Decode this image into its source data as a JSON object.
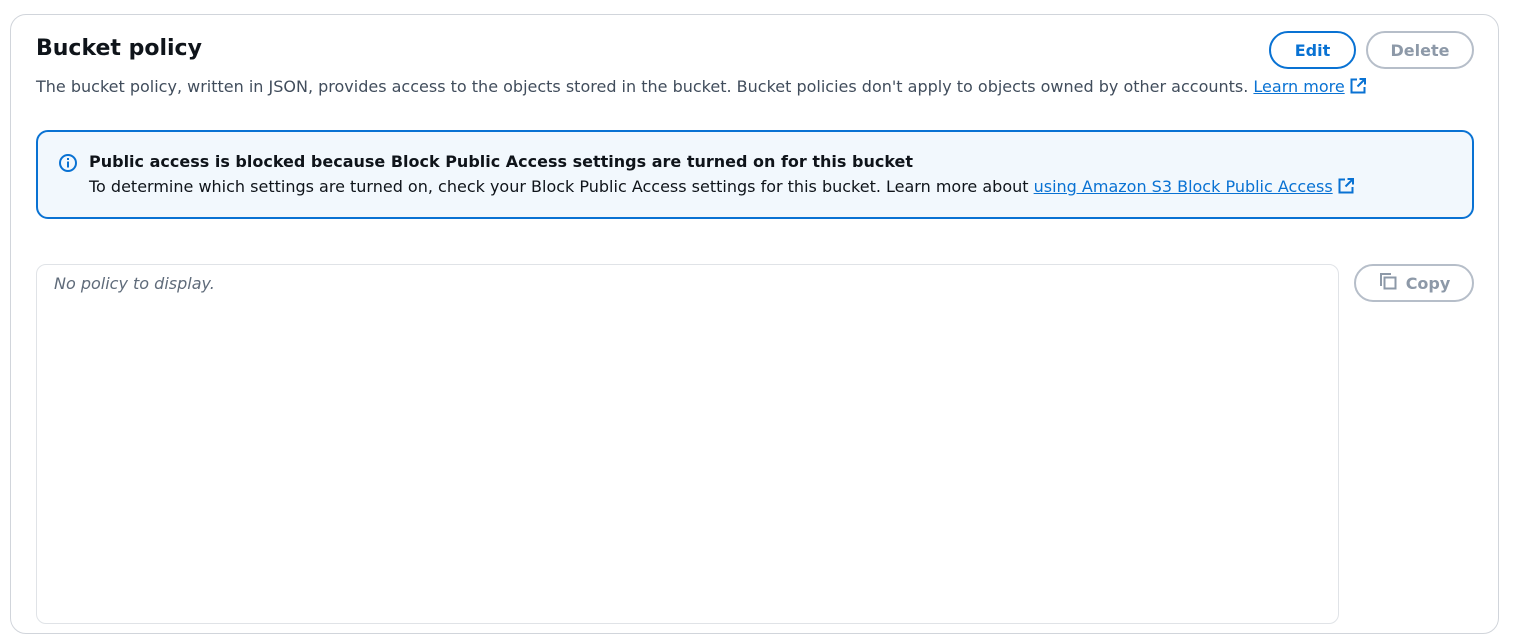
{
  "section": {
    "title": "Bucket policy",
    "description": "The bucket policy, written in JSON, provides access to the objects stored in the bucket. Bucket policies don't apply to objects owned by other accounts.",
    "learn_more": "Learn more"
  },
  "actions": {
    "edit_label": "Edit",
    "delete_label": "Delete",
    "copy_label": "Copy"
  },
  "alert": {
    "title": "Public access is blocked because Block Public Access settings are turned on for this bucket",
    "body": "To determine which settings are turned on, check your Block Public Access settings for this bucket. Learn more about",
    "link": "using Amazon S3 Block Public Access",
    "type": "info"
  },
  "policy": {
    "empty_text": "No policy to display."
  },
  "colors": {
    "link": "#0972d3",
    "alert_bg": "#f2f8fd",
    "alert_border": "#0972d3",
    "disabled": "#8d99a8"
  },
  "icons": [
    "external-link-icon",
    "info-icon",
    "copy-icon"
  ]
}
